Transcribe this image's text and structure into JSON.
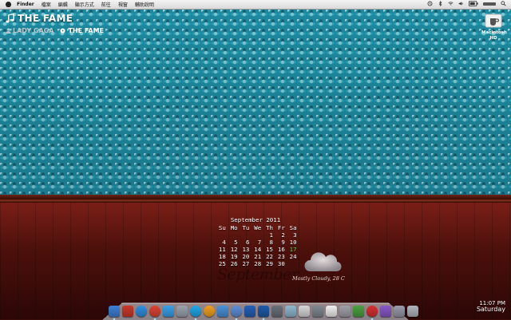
{
  "menubar": {
    "app": "Finder",
    "items": [
      "檔案",
      "編輯",
      "顯示方式",
      "前往",
      "視窗",
      "輔助說明"
    ],
    "status_icons": [
      "wifi-icon",
      "volume-icon",
      "battery-icon",
      "time-machine-icon",
      "bluetooth-icon",
      "spotlight-icon"
    ]
  },
  "now_playing": {
    "title": "THE FAME",
    "artist": "LADY GAGA",
    "album": "THE FAME"
  },
  "desktop": {
    "hd_label_line1": "Macintosh",
    "hd_label_line2": "HD"
  },
  "calendar": {
    "header": "September 2011",
    "weekdays": [
      "Su",
      "Mo",
      "Tu",
      "We",
      "Th",
      "Fr",
      "Sa"
    ],
    "weeks": [
      [
        "",
        "",
        "",
        "",
        "1",
        "2",
        "3"
      ],
      [
        "4",
        "5",
        "6",
        "7",
        "8",
        "9",
        "10"
      ],
      [
        "11",
        "12",
        "13",
        "14",
        "15",
        "16",
        "17"
      ],
      [
        "18",
        "19",
        "20",
        "21",
        "22",
        "23",
        "24"
      ],
      [
        "25",
        "26",
        "27",
        "28",
        "29",
        "30",
        ""
      ]
    ],
    "today": "17",
    "month_script": "September"
  },
  "weather": {
    "text": "Mostly Cloudy, 28 C",
    "icon": "cloud-icon"
  },
  "clock": {
    "time": "11:07 PM",
    "day": "Saturday"
  },
  "dock": {
    "apps": [
      {
        "name": "finder-icon",
        "color": "#3d7fd6",
        "running": true
      },
      {
        "name": "activity-icon",
        "color": "#c83a2a",
        "running": false
      },
      {
        "name": "safari-icon",
        "color": "#2f8fe0",
        "running": false,
        "round": true
      },
      {
        "name": "chrome-icon",
        "color": "#dd4433",
        "running": true,
        "round": true
      },
      {
        "name": "app-store-icon",
        "color": "#3aa0e8",
        "running": false
      },
      {
        "name": "mail-icon",
        "color": "#9aa4ae",
        "running": false
      },
      {
        "name": "skype-icon",
        "color": "#20a8e8",
        "running": true,
        "round": true
      },
      {
        "name": "adium-icon",
        "color": "#f0a020",
        "running": false,
        "round": true
      },
      {
        "name": "quicktime-icon",
        "color": "#4a90d8",
        "running": false
      },
      {
        "name": "itunes-icon",
        "color": "#5d8fd8",
        "running": true,
        "round": true
      },
      {
        "name": "music-icon",
        "color": "#2460b8",
        "running": false
      },
      {
        "name": "photoshop-icon",
        "color": "#1e5aa8",
        "running": true
      },
      {
        "name": "iphoto-icon",
        "color": "#6a7078",
        "running": false
      },
      {
        "name": "preview-icon",
        "color": "#8fb8d0",
        "running": false
      },
      {
        "name": "vlc-icon",
        "color": "#d8d8d8",
        "running": false
      },
      {
        "name": "system-prefs-icon",
        "color": "#808890",
        "running": false
      },
      {
        "name": "textedit-icon",
        "color": "#f0f0f0",
        "running": false
      },
      {
        "name": "utility-icon",
        "color": "#a0a0a8",
        "running": false
      },
      {
        "name": "utorrent-icon",
        "color": "#4aa040",
        "running": false
      },
      {
        "name": "emoticon-icon",
        "color": "#d83030",
        "running": true,
        "round": true
      },
      {
        "name": "downloads-stack-icon",
        "color": "#8858c8",
        "running": false
      },
      {
        "name": "documents-stack-icon",
        "color": "#9a9aa8",
        "running": false
      },
      {
        "name": "trash-icon",
        "color": "#b0b4bc",
        "running": false
      }
    ]
  }
}
